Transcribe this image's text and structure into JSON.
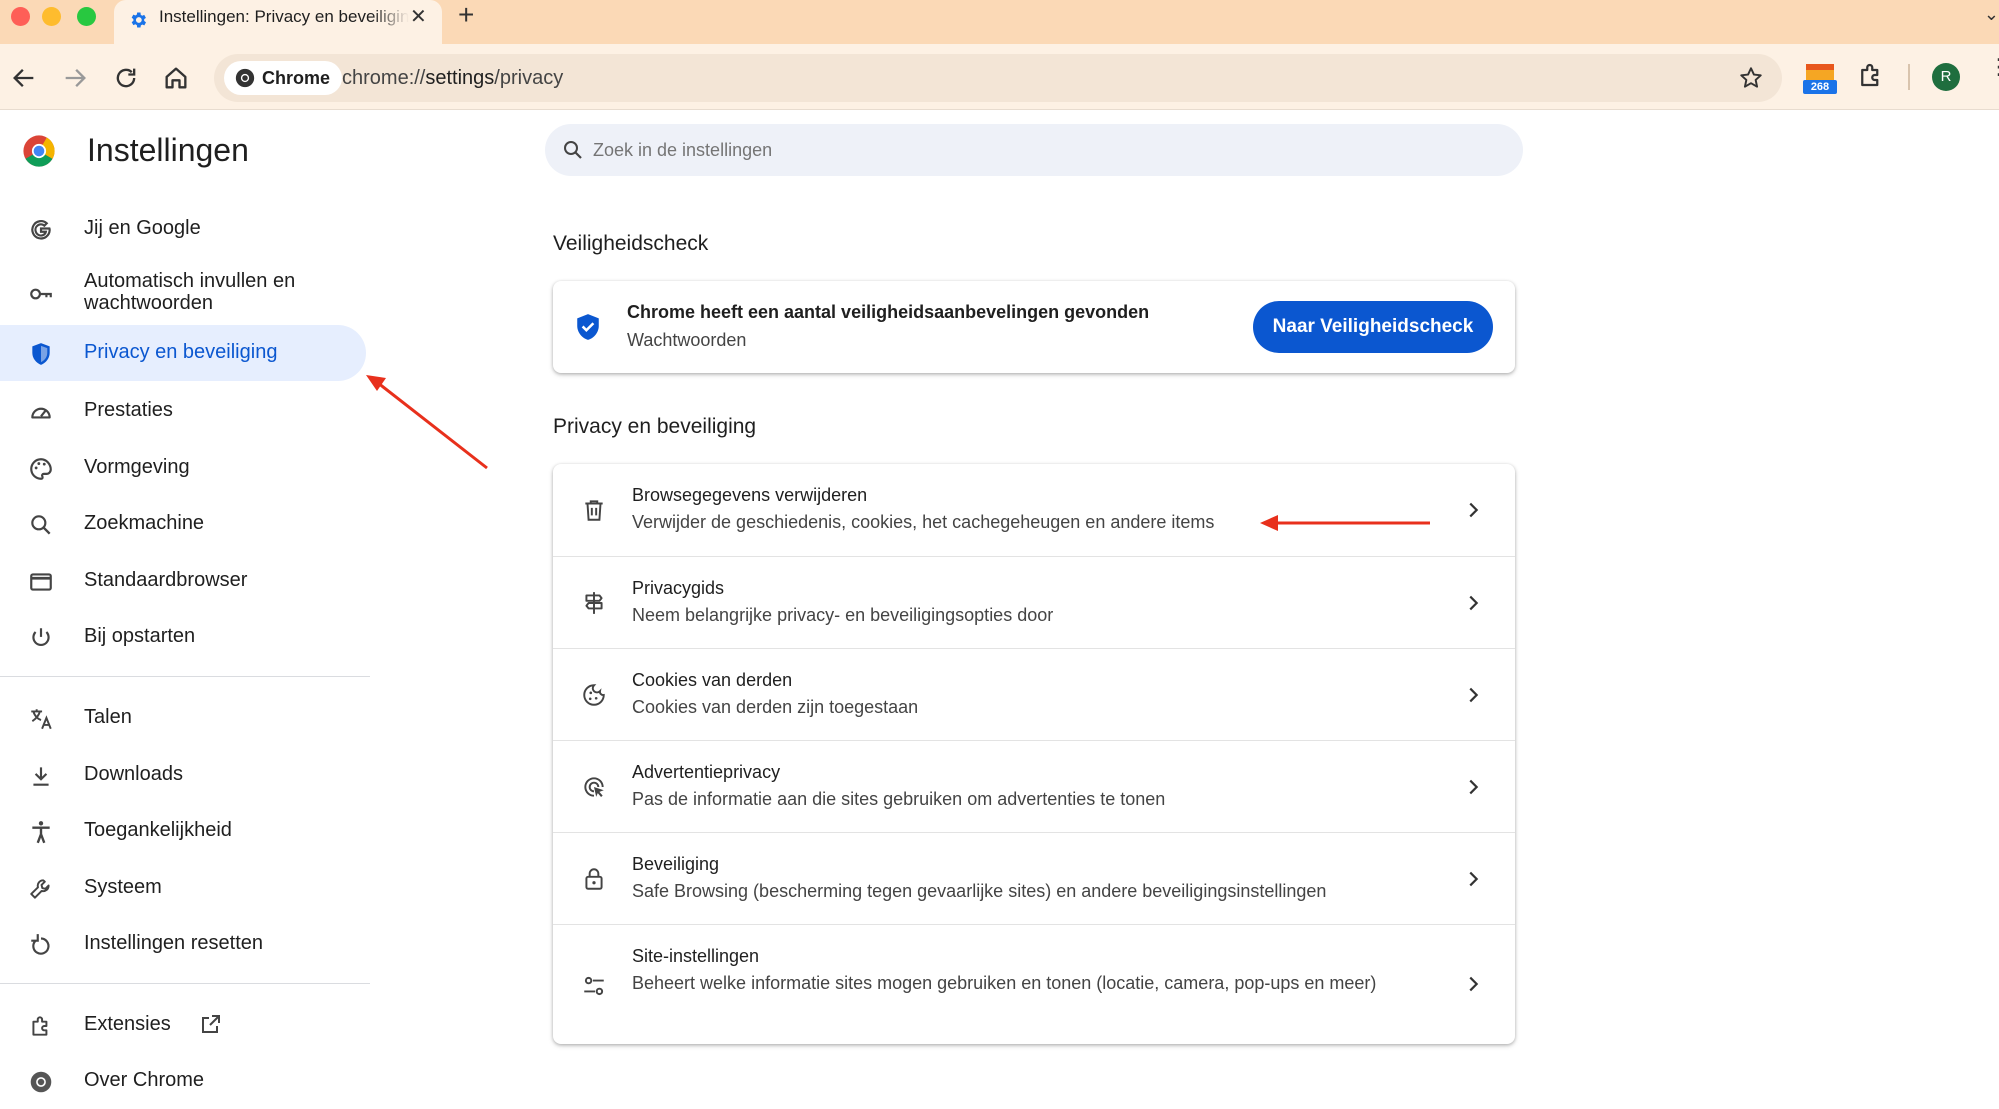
{
  "browser": {
    "tab_title": "Instellingen: Privacy en beveiliging",
    "chip_label": "Chrome",
    "url_scheme": "chrome://",
    "url_host": "settings",
    "url_path": "/privacy",
    "extension_badge_count": "268",
    "profile_initial": "R"
  },
  "sidebar": {
    "title": "Instellingen",
    "items": [
      {
        "label": "Jij en Google",
        "icon": "google-g-icon"
      },
      {
        "label": "Automatisch invullen en wachtwoorden",
        "icon": "key-icon"
      },
      {
        "label": "Privacy en beveiliging",
        "icon": "shield-icon",
        "active": true
      },
      {
        "label": "Prestaties",
        "icon": "speedometer-icon"
      },
      {
        "label": "Vormgeving",
        "icon": "palette-icon"
      },
      {
        "label": "Zoekmachine",
        "icon": "search-icon"
      },
      {
        "label": "Standaardbrowser",
        "icon": "browser-window-icon"
      },
      {
        "label": "Bij opstarten",
        "icon": "power-icon"
      },
      {
        "label": "Talen",
        "icon": "translate-icon"
      },
      {
        "label": "Downloads",
        "icon": "download-icon"
      },
      {
        "label": "Toegankelijkheid",
        "icon": "accessibility-icon"
      },
      {
        "label": "Systeem",
        "icon": "wrench-icon"
      },
      {
        "label": "Instellingen resetten",
        "icon": "reset-icon"
      },
      {
        "label": "Extensies",
        "icon": "puzzle-icon"
      },
      {
        "label": "Over Chrome",
        "icon": "chrome-icon"
      }
    ]
  },
  "search": {
    "placeholder": "Zoek in de instellingen"
  },
  "safety_check": {
    "section_title": "Veiligheidscheck",
    "title": "Chrome heeft een aantal veiligheidsaanbevelingen gevonden",
    "subtitle": "Wachtwoorden",
    "button_label": "Naar Veiligheidscheck"
  },
  "privacy": {
    "section_title": "Privacy en beveiliging",
    "rows": [
      {
        "title": "Browsegegevens verwijderen",
        "subtitle": "Verwijder de geschiedenis, cookies, het cachegeheugen en andere items",
        "icon": "trash-icon"
      },
      {
        "title": "Privacygids",
        "subtitle": "Neem belangrijke privacy- en beveiligingsopties door",
        "icon": "signpost-icon"
      },
      {
        "title": "Cookies van derden",
        "subtitle": "Cookies van derden zijn toegestaan",
        "icon": "cookie-icon"
      },
      {
        "title": "Advertentieprivacy",
        "subtitle": "Pas de informatie aan die sites gebruiken om advertenties te tonen",
        "icon": "ad-privacy-icon"
      },
      {
        "title": "Beveiliging",
        "subtitle": "Safe Browsing (bescherming tegen gevaarlijke sites) en andere beveiligingsinstellingen",
        "icon": "lock-icon"
      },
      {
        "title": "Site-instellingen",
        "subtitle": "Beheert welke informatie sites mogen gebruiken en tonen (locatie, camera, pop-ups en meer)",
        "icon": "sliders-icon"
      }
    ]
  },
  "colors": {
    "accent": "#0b57d0",
    "active_nav_bg": "#e6eefe",
    "annotation_arrow": "#e8301c",
    "tab_strip": "#fbd9b6"
  }
}
